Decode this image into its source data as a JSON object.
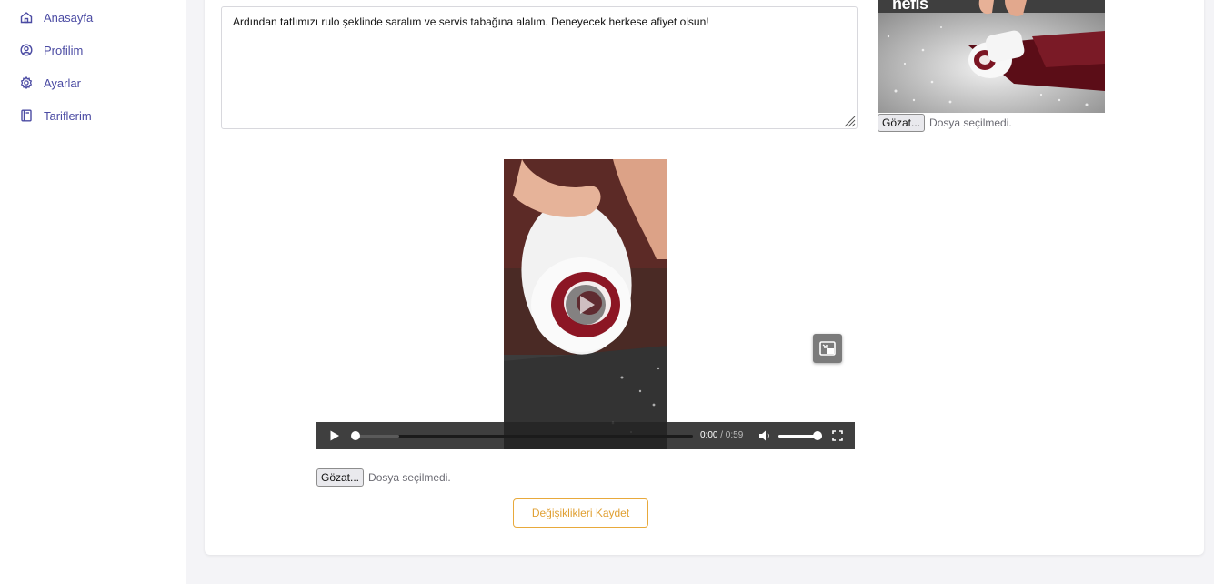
{
  "sidebar": {
    "items": [
      {
        "label": "Anasayfa",
        "icon": "home-icon"
      },
      {
        "label": "Profilim",
        "icon": "user-circle-icon"
      },
      {
        "label": "Ayarlar",
        "icon": "gear-icon"
      },
      {
        "label": "Tariflerim",
        "icon": "book-icon"
      }
    ]
  },
  "recipe": {
    "step_text": "Ardından tatlımızı rulo şeklinde saralım ve servis tabağına alalım. Deneyecek herkese afiyet olsun!"
  },
  "thumbnail": {
    "watermark": "nefis"
  },
  "image_upload": {
    "button_label": "Gözat...",
    "status": "Dosya seçilmedi."
  },
  "video": {
    "current_time": "0:00",
    "duration": "/ 0:59",
    "progress": 0.0,
    "volume": 0.85
  },
  "video_upload": {
    "button_label": "Gözat...",
    "status": "Dosya seçilmedi."
  },
  "actions": {
    "save_label": "Değişiklikleri Kaydet"
  },
  "colors": {
    "accent": "#e0a033",
    "nav": "#4b4ba3"
  }
}
